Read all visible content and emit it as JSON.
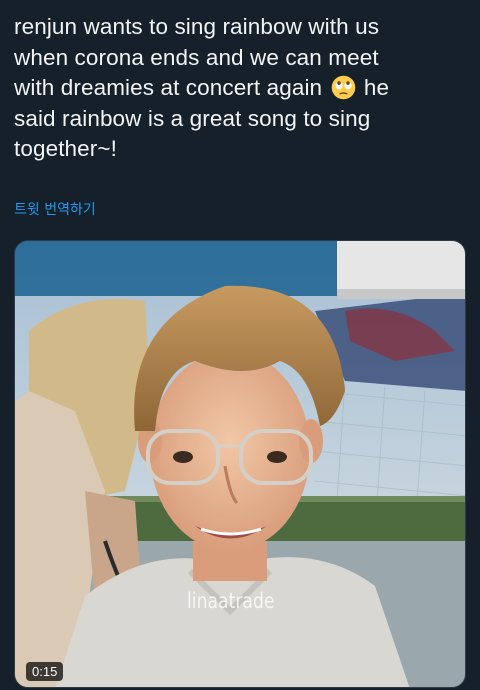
{
  "tweet": {
    "text_before_emoji": "renjun wants to sing rainbow with us\nwhen corona ends and we can meet\nwith dreamies at concert again ",
    "emoji": "face-with-rolling-eyes-emoji",
    "text_after_emoji": " he\nsaid rainbow is a great song to sing\ntogether~!",
    "translate_label": "트윗 번역하기"
  },
  "media": {
    "type": "video",
    "watermark": "linaatrade",
    "duration": "0:15"
  },
  "colors": {
    "background": "#15202b",
    "text": "#f2f4f5",
    "link": "#1d9bf0"
  }
}
